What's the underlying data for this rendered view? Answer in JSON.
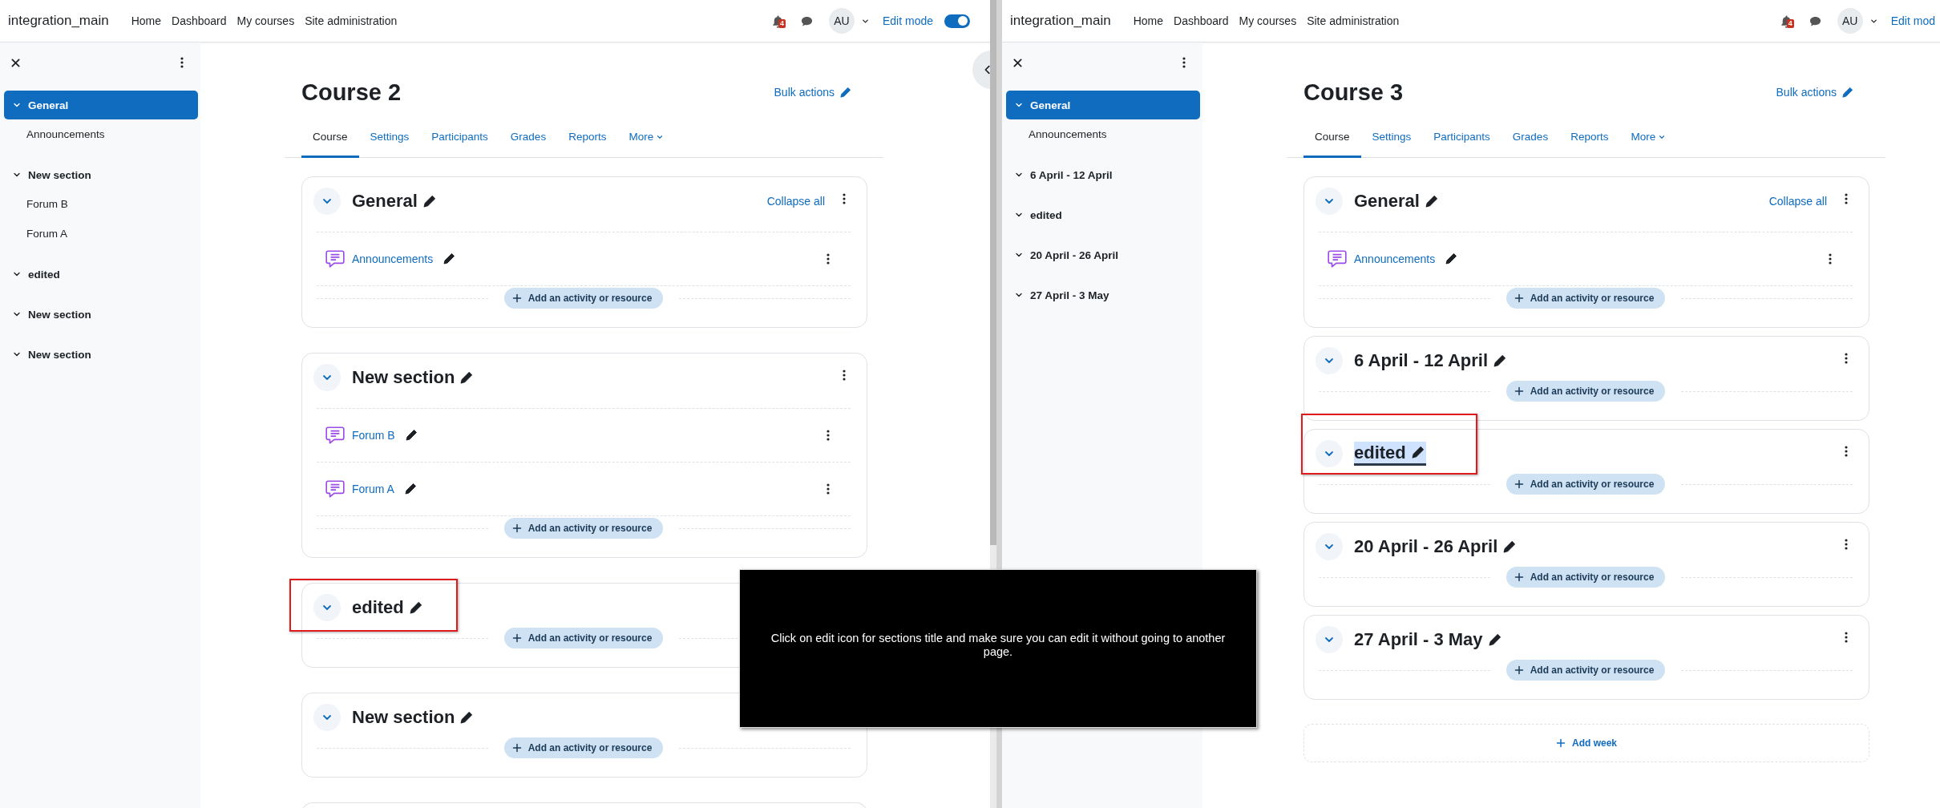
{
  "panes": [
    {
      "site_name": "integration_main",
      "nav": [
        "Home",
        "Dashboard",
        "My courses",
        "Site administration"
      ],
      "notification_count": "4",
      "avatar": "AU",
      "edit_mode": {
        "label": "Edit mode",
        "on": true
      },
      "drawer_toggle": true,
      "course_index": [
        {
          "label": "General",
          "selected": true,
          "children": [
            {
              "label": "Announcements",
              "selected": false
            }
          ]
        },
        {
          "label": "New section",
          "selected": false,
          "children": [
            {
              "label": "Forum B",
              "selected": false
            },
            {
              "label": "Forum A",
              "selected": false
            }
          ]
        },
        {
          "label": "edited",
          "selected": false
        },
        {
          "label": "New section",
          "selected": false
        },
        {
          "label": "New section",
          "selected": false
        }
      ],
      "course": {
        "title": "Course 2",
        "bulk_actions": "Bulk actions",
        "tabs": [
          {
            "label": "Course",
            "selected": true,
            "kind": "link"
          },
          {
            "label": "Settings",
            "selected": false,
            "kind": "link"
          },
          {
            "label": "Participants",
            "selected": false,
            "kind": "link"
          },
          {
            "label": "Grades",
            "selected": false,
            "kind": "link"
          },
          {
            "label": "Reports",
            "selected": false,
            "kind": "link"
          },
          {
            "label": "More",
            "selected": false,
            "kind": "menu"
          }
        ],
        "sections": [
          {
            "title": "General",
            "collapse_all": "Collapse all",
            "menu": true,
            "editing": false,
            "highlighted": false,
            "activities": [
              {
                "name": "Announcements"
              }
            ],
            "add_label": "Add an activity or resource"
          },
          {
            "title": "New section",
            "menu": true,
            "editing": false,
            "highlighted": false,
            "activities": [
              {
                "name": "Forum B"
              },
              {
                "name": "Forum A"
              }
            ],
            "add_label": "Add an activity or resource"
          },
          {
            "title": "edited",
            "menu": false,
            "editing": false,
            "highlighted": true,
            "add_label": "Add an activity or resource"
          },
          {
            "title": "New section",
            "menu": false,
            "editing": false,
            "highlighted": false,
            "add_label": "Add an activity or resource"
          }
        ],
        "more_below": true
      }
    },
    {
      "site_name": "integration_main",
      "nav": [
        "Home",
        "Dashboard",
        "My courses",
        "Site administration"
      ],
      "notification_count": "4",
      "avatar": "AU",
      "edit_mode": {
        "label": "Edit mod"
      },
      "drawer_toggle": false,
      "course_index": [
        {
          "label": "General",
          "selected": true,
          "children": [
            {
              "label": "Announcements",
              "selected": false
            }
          ]
        },
        {
          "label": "6 April - 12 April",
          "selected": false
        },
        {
          "label": "edited",
          "selected": false
        },
        {
          "label": "20 April - 26 April",
          "selected": false
        },
        {
          "label": "27 April - 3 May",
          "selected": false
        }
      ],
      "course": {
        "title": "Course 3",
        "bulk_actions": "Bulk actions",
        "tabs": [
          {
            "label": "Course",
            "selected": true,
            "kind": "link"
          },
          {
            "label": "Settings",
            "selected": false,
            "kind": "link"
          },
          {
            "label": "Participants",
            "selected": false,
            "kind": "link"
          },
          {
            "label": "Grades",
            "selected": false,
            "kind": "link"
          },
          {
            "label": "Reports",
            "selected": false,
            "kind": "link"
          },
          {
            "label": "More",
            "selected": false,
            "kind": "menu"
          }
        ],
        "sections": [
          {
            "title": "General",
            "collapse_all": "Collapse all",
            "menu": true,
            "editing": false,
            "highlighted": false,
            "activities": [
              {
                "name": "Announcements"
              }
            ],
            "add_label": "Add an activity or resource"
          },
          {
            "title": "6 April - 12 April",
            "menu": true,
            "editing": false,
            "highlighted": false,
            "add_label": "Add an activity or resource"
          },
          {
            "title": "edited",
            "menu": true,
            "editing": true,
            "highlighted": true,
            "add_label": "Add an activity or resource"
          },
          {
            "title": "20 April - 26 April",
            "menu": true,
            "editing": false,
            "highlighted": false,
            "add_label": "Add an activity or resource"
          },
          {
            "title": "27 April - 3 May",
            "menu": true,
            "editing": false,
            "highlighted": false,
            "add_label": "Add an activity or resource"
          }
        ],
        "add_section": "Add week"
      }
    }
  ],
  "instruction_overlay": {
    "text": "Click on edit icon for sections title and make sure you can edit it without going to another page."
  }
}
